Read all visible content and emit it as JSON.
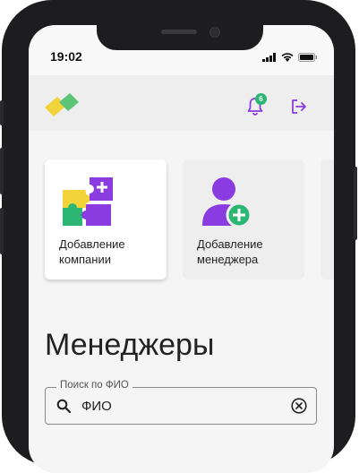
{
  "status_bar": {
    "time": "19:02"
  },
  "header": {
    "notification_count": "6"
  },
  "cards": [
    {
      "label": "Добавление компании",
      "icon": "puzzle-pieces-icon"
    },
    {
      "label": "Добавление менеджера",
      "icon": "add-user-icon"
    }
  ],
  "main": {
    "title": "Менеджеры",
    "search": {
      "legend": "Поиск по ФИО",
      "placeholder": "ФИО",
      "value": ""
    }
  },
  "colors": {
    "accent": "#8a3ce0",
    "badge": "#2bb673",
    "logo_yellow": "#f3d33a",
    "logo_green": "#5cc476"
  }
}
